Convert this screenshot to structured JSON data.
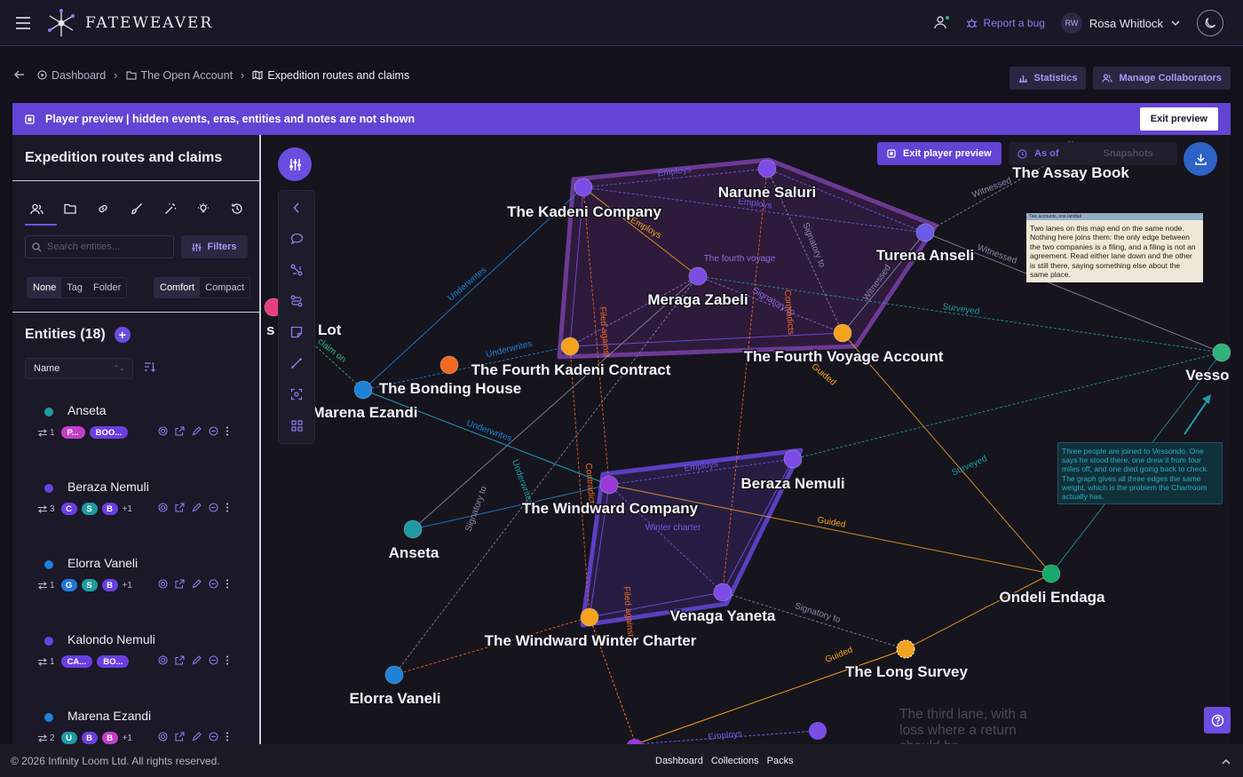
{
  "app": {
    "name": "FATEWEAVER"
  },
  "header": {
    "report_bug": "Report a bug",
    "user_initials": "RW",
    "user_name": "Rosa Whitlock"
  },
  "breadcrumb": {
    "items": [
      "Dashboard",
      "The Open Account",
      "Expedition routes and claims"
    ]
  },
  "actions": {
    "statistics": "Statistics",
    "manage_collaborators": "Manage Collaborators"
  },
  "banner": {
    "text": "Player preview | hidden events, eras, entities and notes are not shown",
    "exit": "Exit preview"
  },
  "sidebar": {
    "title": "Expedition routes and claims",
    "search_placeholder": "Search entities...",
    "filters": "Filters",
    "grouping": [
      "None",
      "Tag",
      "Folder"
    ],
    "density": [
      "Comfort",
      "Compact"
    ],
    "entities_title": "Entities (18)",
    "sort": "Name",
    "entities": [
      {
        "name": "Anseta",
        "color": "#1f9aa3",
        "count": "1",
        "chips": [
          {
            "label": "P...",
            "color": "#c23fc9"
          },
          {
            "label": "BOO...",
            "color": "#6a3fe0"
          }
        ],
        "more": ""
      },
      {
        "name": "Beraza Nemuli",
        "color": "#6b45e3",
        "count": "3",
        "chips": [
          {
            "label": "C",
            "color": "#6a3fe0"
          },
          {
            "label": "S",
            "color": "#1f9aa3"
          },
          {
            "label": "B",
            "color": "#6a3fe0"
          }
        ],
        "more": "+1"
      },
      {
        "name": "Elorra Vaneli",
        "color": "#1f82d8",
        "count": "1",
        "chips": [
          {
            "label": "G",
            "color": "#2277d6"
          },
          {
            "label": "S",
            "color": "#1f9aa3"
          },
          {
            "label": "B",
            "color": "#6a3fe0"
          }
        ],
        "more": "+1"
      },
      {
        "name": "Kalondo Nemuli",
        "color": "#6b45e3",
        "count": "1",
        "chips": [
          {
            "label": "CA...",
            "color": "#6a3fe0"
          },
          {
            "label": "BO...",
            "color": "#6a3fe0"
          }
        ],
        "more": ""
      },
      {
        "name": "Marena Ezandi",
        "color": "#1f82d8",
        "count": "2",
        "chips": [
          {
            "label": "U",
            "color": "#1f9aa3"
          },
          {
            "label": "B",
            "color": "#6a3fe0"
          },
          {
            "label": "B",
            "color": "#c23fc9"
          }
        ],
        "more": "+1"
      }
    ]
  },
  "canvas": {
    "exit_player_preview": "Exit player preview",
    "as_of": "As of",
    "snapshots": "Snapshots",
    "note_top_header": "Two accounts, one landfall",
    "note_top": "Two lanes on this map end on the same node. Nothing here joins them: the only edge between the two companies is a filing, and a filing is not an agreement. Read either lane down and the other is still there, saying something else about the same place.",
    "note_right": "Three people are joined to Vessondo. One says he stood there, one drew it from four miles off, and one died going back to check. The graph gives all three edges the same weight, which is the problem the Chartroom actually has.",
    "ghost_note": "The third lane, with a loss where a return should be",
    "nodes": [
      {
        "label": "The Kadeni Company"
      },
      {
        "label": "Narune Saluri"
      },
      {
        "label": "Turena Anseli"
      },
      {
        "label": "Meraga Zabeli"
      },
      {
        "label": "The Fourth Kadeni Contract"
      },
      {
        "label": "The Fourth Voyage Account"
      },
      {
        "label": "The Bonding House"
      },
      {
        "label": "Marena Ezandi"
      },
      {
        "label": "The Assay Book"
      },
      {
        "label": "Vesso"
      },
      {
        "label": "The Windward Company"
      },
      {
        "label": "Beraza Nemuli"
      },
      {
        "label": "Anseta"
      },
      {
        "label": "Venaga Yaneta"
      },
      {
        "label": "The Windward Winter Charter"
      },
      {
        "label": "Ondeli Endaga"
      },
      {
        "label": "Elorra Vaneli"
      },
      {
        "label": "The Long Survey"
      },
      {
        "label": "Lot"
      },
      {
        "label": "s"
      }
    ],
    "edges": {
      "employs": "Employs",
      "underwrites": "Underwrites",
      "witnessed": "Witnessed",
      "surveyed": "Surveyed",
      "guided": "Guided",
      "signatory_to": "Signatory to",
      "contradicts": "Contradicts",
      "filed_against": "Filed against",
      "the_fourth_voyage": "The fourth voyage",
      "winter_charter": "Winter charter",
      "claim_on": "claim on"
    }
  },
  "footer": {
    "copyright": "© 2026 Infinity Loom Ltd. All rights reserved.",
    "links": [
      "Dashboard",
      "Collections",
      "Packs"
    ]
  }
}
